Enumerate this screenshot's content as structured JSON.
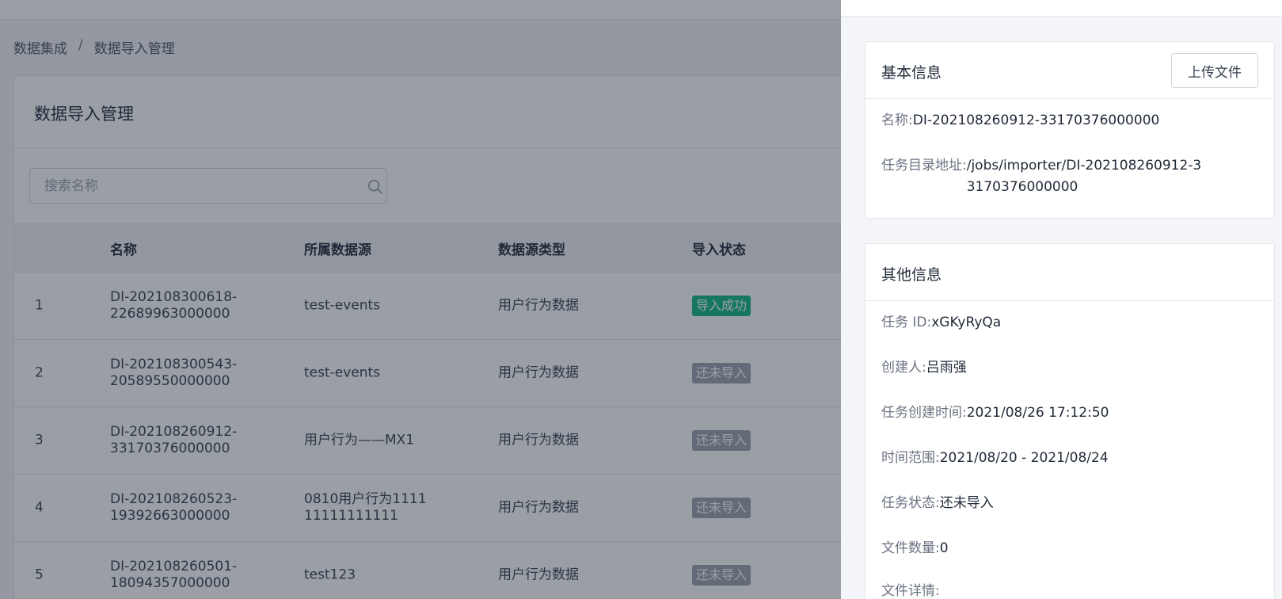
{
  "breadcrumb": [
    "数据集成",
    "/",
    "数据导入管理"
  ],
  "page": {
    "title": "数据导入管理",
    "search_placeholder": "搜索名称"
  },
  "table": {
    "headers": [
      "名称",
      "所属数据源",
      "数据源类型",
      "导入状态"
    ],
    "rows": [
      {
        "idx": "1",
        "name": "DI-202108300618-22689963000000",
        "source": "test-events",
        "type": "用户行为数据",
        "status": "导入成功"
      },
      {
        "idx": "2",
        "name": "DI-202108300543-20589550000000",
        "source": "test-events",
        "type": "用户行为数据",
        "status": "还未导入"
      },
      {
        "idx": "3",
        "name": "DI-202108260912-33170376000000",
        "source": "用户行为——MX1",
        "type": "用户行为数据",
        "status": "还未导入"
      },
      {
        "idx": "4",
        "name": "DI-202108260523-19392663000000",
        "source": "0810用户行为111111111111111",
        "type": "用户行为数据",
        "status": "还未导入"
      },
      {
        "idx": "5",
        "name": "DI-202108260501-18094357000000",
        "source": "test123",
        "type": "用户行为数据",
        "status": "还未导入"
      }
    ]
  },
  "drawer": {
    "basic": {
      "title": "基本信息",
      "upload_label": "上传文件",
      "name_key": "名称:",
      "name_value": "DI-202108260912-33170376000000",
      "dir_key": "任务目录地址:",
      "dir_value": "/jobs/importer/DI-202108260912-33170376000000"
    },
    "other": {
      "title": "其他信息",
      "fields": [
        {
          "k": "任务 ID:",
          "v": "xGKyRyQa"
        },
        {
          "k": "创建人:",
          "v": "吕雨强"
        },
        {
          "k": "任务创建时间:",
          "v": "2021/08/26 17:12:50"
        },
        {
          "k": "时间范围:",
          "v": "2021/08/20 - 2021/08/24"
        },
        {
          "k": "任务状态:",
          "v": "还未导入"
        },
        {
          "k": "文件数量:",
          "v": "0"
        },
        {
          "k": "文件详情:",
          "v": ""
        }
      ]
    }
  },
  "colors": {
    "success": "#10b981",
    "pending": "#9ca3af",
    "mask": "rgba(31,41,55,0.45)"
  }
}
